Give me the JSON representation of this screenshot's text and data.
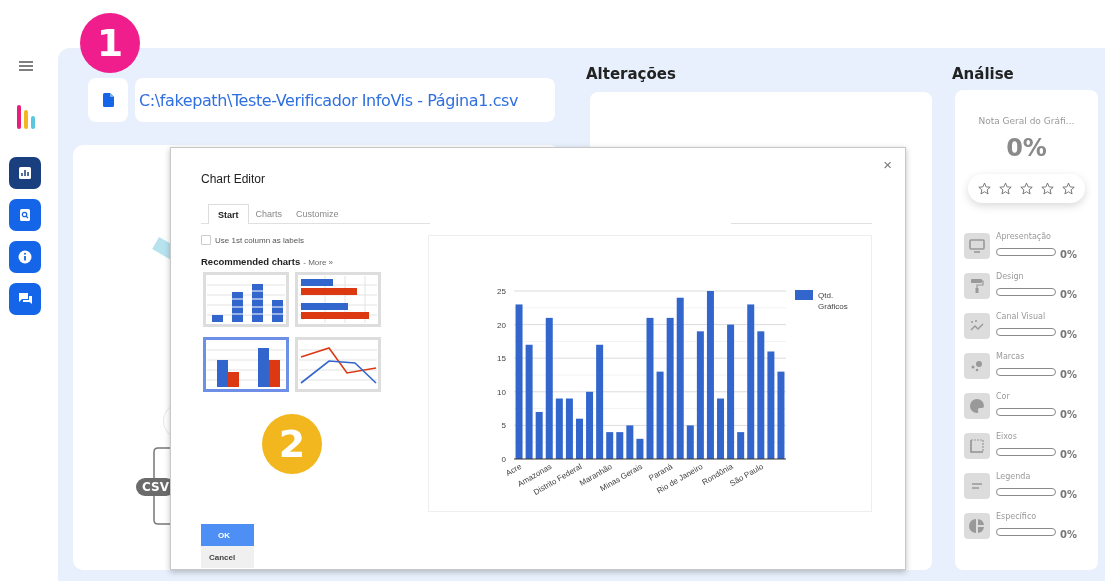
{
  "step_badges": [
    {
      "label": "1",
      "color": "#f01e8c"
    },
    {
      "label": "2",
      "color": "#f2b71f"
    }
  ],
  "sidebar": {
    "items": [
      {
        "selected": true
      },
      {
        "selected": false
      },
      {
        "selected": false
      },
      {
        "selected": false
      }
    ]
  },
  "file": {
    "path": "C:\\fakepath\\Teste-Verificador InfoVis - Página1.csv"
  },
  "canvas": {
    "badge": "CSV"
  },
  "alteracoes": {
    "title": "Alterações"
  },
  "dialog": {
    "title": "Chart Editor",
    "close": "×",
    "tabs": [
      {
        "label": "Start",
        "selected": true
      },
      {
        "label": "Charts",
        "selected": false
      },
      {
        "label": "Customize",
        "selected": false
      }
    ],
    "option": {
      "label": "Use 1st column as labels",
      "checked": false
    },
    "recommended": {
      "title": "Recommended charts",
      "more": "- More »",
      "thumbnails": [
        {
          "kind": "stacked",
          "selected": false
        },
        {
          "kind": "bar",
          "selected": false
        },
        {
          "kind": "column",
          "selected": true
        },
        {
          "kind": "line",
          "selected": false
        }
      ]
    },
    "chart_data": {
      "type": "bar",
      "series": [
        {
          "name": "Qtd. Gráficos",
          "color": "#3366cc",
          "values": [
            23,
            17,
            7,
            21,
            9,
            9,
            6,
            10,
            17,
            4,
            4,
            5,
            3,
            21,
            13,
            21,
            24,
            5,
            19,
            25,
            9,
            20,
            4,
            23,
            19,
            16,
            13
          ]
        }
      ],
      "ylim": [
        0,
        25
      ],
      "yticks": [
        0,
        5,
        10,
        15,
        20,
        25
      ],
      "grid": true,
      "categories": [
        "Acre",
        null,
        null,
        "Amazonas",
        null,
        null,
        "Distrito Federal",
        null,
        null,
        "Maranhão",
        null,
        null,
        "Minas Gerais",
        null,
        null,
        "Paraná",
        null,
        null,
        "Rio de Janeiro",
        null,
        null,
        "Rondônia",
        null,
        null,
        "São Paulo",
        null,
        null
      ]
    },
    "buttons": [
      {
        "label": "OK",
        "kind": "primary"
      },
      {
        "label": "Cancel",
        "kind": "secondary"
      }
    ]
  },
  "analise": {
    "title": "Análise",
    "score_label": "Nota Geral do Gráfi…",
    "score": "0%",
    "stars": 0,
    "criteria": [
      {
        "label": "Apresentação",
        "level": 0,
        "reading": "0%"
      },
      {
        "label": "Design",
        "level": 0,
        "reading": "0%"
      },
      {
        "label": "Canal Visual",
        "level": 0,
        "reading": "0%"
      },
      {
        "label": "Marcas",
        "level": 0,
        "reading": "0%"
      },
      {
        "label": "Cor",
        "level": 0,
        "reading": "0%"
      },
      {
        "label": "Eixos",
        "level": 0,
        "reading": "0%"
      },
      {
        "label": "Legenda",
        "level": 0,
        "reading": "0%"
      },
      {
        "label": "Específico",
        "level": 0,
        "reading": "0%"
      }
    ]
  }
}
